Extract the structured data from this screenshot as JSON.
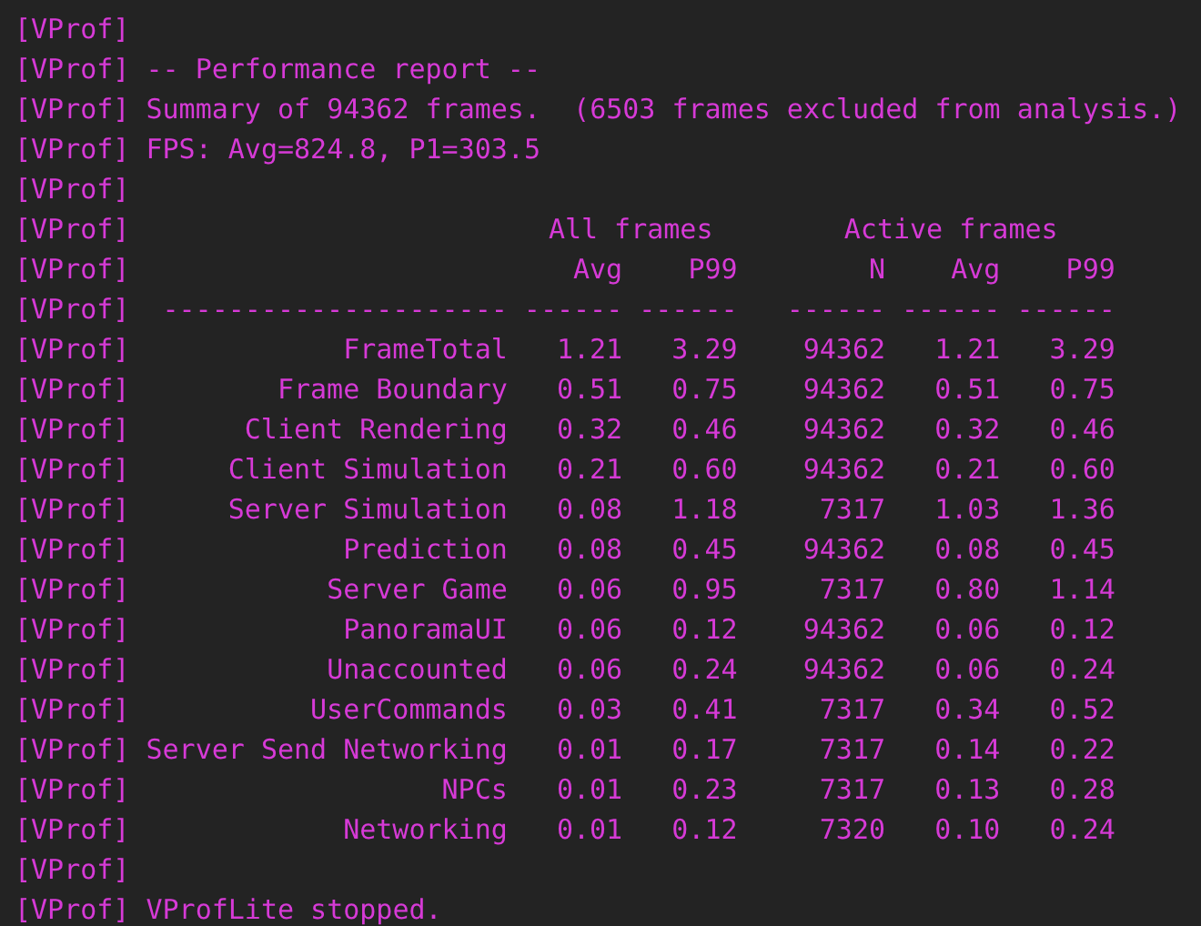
{
  "lines": [
    {
      "kind": "blank",
      "prefix": "[VProf]"
    },
    {
      "kind": "text",
      "prefix": "[VProf]",
      "text": "-- Performance report --"
    },
    {
      "kind": "text",
      "prefix": "[VProf]",
      "text": "Summary of 94362 frames.  (6503 frames excluded from analysis.)"
    },
    {
      "kind": "text",
      "prefix": "[VProf]",
      "text": "FPS: Avg=824.8, P1=303.5"
    },
    {
      "kind": "blank",
      "prefix": "[VProf]"
    },
    {
      "kind": "groups",
      "prefix": "[VProf]",
      "all": "All frames",
      "active": "Active frames"
    },
    {
      "kind": "row",
      "prefix": "[VProf]",
      "cells": [
        "",
        "Avg",
        "P99",
        "N",
        "Avg",
        "P99"
      ]
    },
    {
      "kind": "row",
      "prefix": "[VProf]",
      "cells": [
        "---------------------",
        "------",
        "------",
        "------",
        "------",
        "------"
      ]
    },
    {
      "kind": "row",
      "prefix": "[VProf]",
      "cells": [
        "FrameTotal",
        "1.21",
        "3.29",
        "94362",
        "1.21",
        "3.29"
      ]
    },
    {
      "kind": "row",
      "prefix": "[VProf]",
      "cells": [
        "Frame Boundary",
        "0.51",
        "0.75",
        "94362",
        "0.51",
        "0.75"
      ]
    },
    {
      "kind": "row",
      "prefix": "[VProf]",
      "cells": [
        "Client Rendering",
        "0.32",
        "0.46",
        "94362",
        "0.32",
        "0.46"
      ]
    },
    {
      "kind": "row",
      "prefix": "[VProf]",
      "cells": [
        "Client Simulation",
        "0.21",
        "0.60",
        "94362",
        "0.21",
        "0.60"
      ]
    },
    {
      "kind": "row",
      "prefix": "[VProf]",
      "cells": [
        "Server Simulation",
        "0.08",
        "1.18",
        "7317",
        "1.03",
        "1.36"
      ]
    },
    {
      "kind": "row",
      "prefix": "[VProf]",
      "cells": [
        "Prediction",
        "0.08",
        "0.45",
        "94362",
        "0.08",
        "0.45"
      ]
    },
    {
      "kind": "row",
      "prefix": "[VProf]",
      "cells": [
        "Server Game",
        "0.06",
        "0.95",
        "7317",
        "0.80",
        "1.14"
      ]
    },
    {
      "kind": "row",
      "prefix": "[VProf]",
      "cells": [
        "PanoramaUI",
        "0.06",
        "0.12",
        "94362",
        "0.06",
        "0.12"
      ]
    },
    {
      "kind": "row",
      "prefix": "[VProf]",
      "cells": [
        "Unaccounted",
        "0.06",
        "0.24",
        "94362",
        "0.06",
        "0.24"
      ]
    },
    {
      "kind": "row",
      "prefix": "[VProf]",
      "cells": [
        "UserCommands",
        "0.03",
        "0.41",
        "7317",
        "0.34",
        "0.52"
      ]
    },
    {
      "kind": "row",
      "prefix": "[VProf]",
      "cells": [
        "Server Send Networking",
        "0.01",
        "0.17",
        "7317",
        "0.14",
        "0.22"
      ]
    },
    {
      "kind": "row",
      "prefix": "[VProf]",
      "cells": [
        "NPCs",
        "0.01",
        "0.23",
        "7317",
        "0.13",
        "0.28"
      ]
    },
    {
      "kind": "row",
      "prefix": "[VProf]",
      "cells": [
        "Networking",
        "0.01",
        "0.12",
        "7320",
        "0.10",
        "0.24"
      ]
    },
    {
      "kind": "blank",
      "prefix": "[VProf]"
    },
    {
      "kind": "text",
      "prefix": "[VProf]",
      "text": "VProfLite stopped."
    }
  ]
}
